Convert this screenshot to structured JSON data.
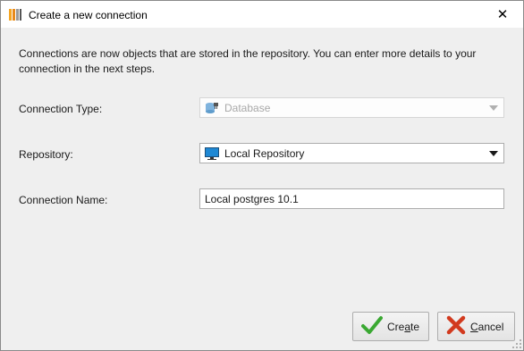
{
  "window": {
    "title": "Create a new connection",
    "close_glyph": "✕"
  },
  "info_text": "Connections are now objects that are stored in the repository. You can enter more details to your connection in the next steps.",
  "form": {
    "connection_type": {
      "label": "Connection Type:",
      "value": "Database",
      "icon": "database-plug-icon",
      "disabled": true
    },
    "repository": {
      "label": "Repository:",
      "value": "Local Repository",
      "icon": "monitor-icon"
    },
    "connection_name": {
      "label": "Connection Name:",
      "value": "Local postgres 10.1"
    }
  },
  "buttons": {
    "create": {
      "pre": "Cre",
      "mnemonic": "a",
      "post": "te",
      "icon": "check-icon"
    },
    "cancel": {
      "pre": "",
      "mnemonic": "C",
      "post": "ancel",
      "icon": "cross-icon"
    }
  },
  "colors": {
    "create_check": "#3aa832",
    "cancel_cross": "#d23a1e",
    "monitor_screen": "#1e88d4"
  }
}
